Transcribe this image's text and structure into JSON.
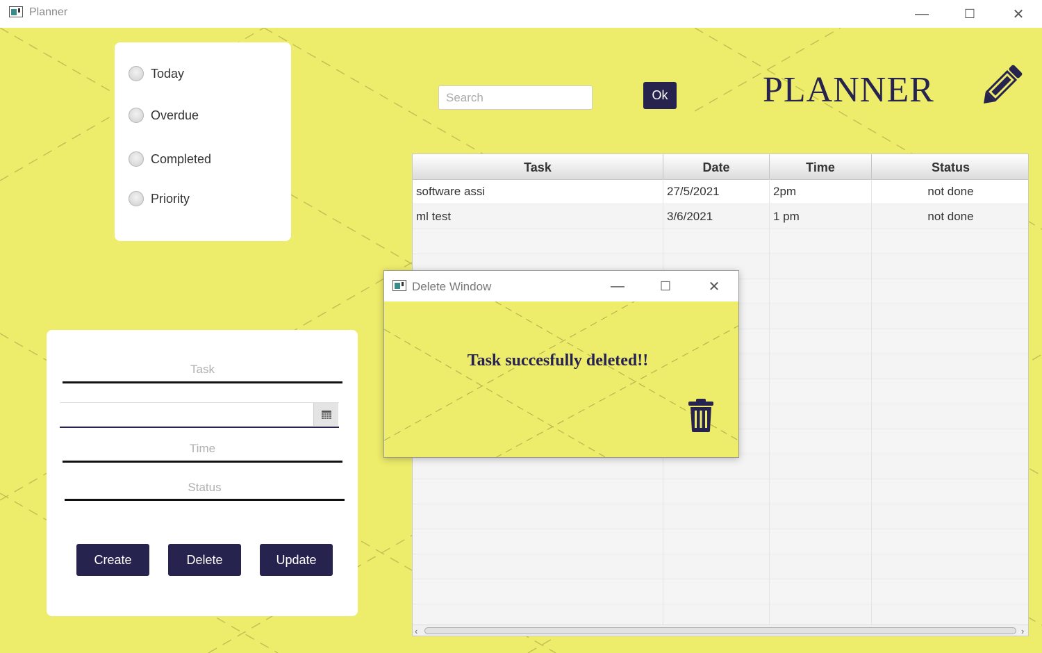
{
  "window": {
    "title": "Planner",
    "minimize": "—",
    "maximize": "☐",
    "close": "✕"
  },
  "filters": [
    {
      "label": "Today",
      "checked": false
    },
    {
      "label": "Overdue",
      "checked": false
    },
    {
      "label": "Completed",
      "checked": false
    },
    {
      "label": "Priority",
      "checked": false
    }
  ],
  "search": {
    "placeholder": "Search",
    "value": "",
    "ok_label": "Ok"
  },
  "header": {
    "title": "PLANNER",
    "icon": "pencil-icon"
  },
  "table": {
    "columns": [
      "Task",
      "Date",
      "Time",
      "Status"
    ],
    "rows": [
      {
        "task": "software assi",
        "date": "27/5/2021",
        "time": "2pm",
        "status": "not done"
      },
      {
        "task": "ml test",
        "date": "3/6/2021",
        "time": "1 pm",
        "status": "not done"
      }
    ]
  },
  "form": {
    "task_placeholder": "Task",
    "time_placeholder": "Time",
    "status_placeholder": "Status",
    "date_value": "",
    "buttons": {
      "create": "Create",
      "delete": "Delete",
      "update": "Update"
    }
  },
  "dialog": {
    "title": "Delete Window",
    "message": "Task succesfully deleted!!",
    "minimize": "—",
    "maximize": "☐",
    "close": "✕",
    "icon": "trash-icon"
  },
  "colors": {
    "background": "#eeec6b",
    "accent": "#27234f",
    "card": "#ffffff"
  }
}
